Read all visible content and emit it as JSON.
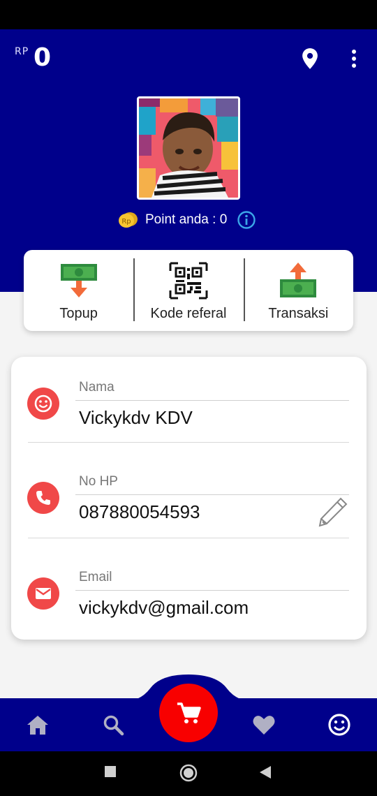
{
  "balance": {
    "currency_label": "RP",
    "amount": "0"
  },
  "header": {
    "location_icon": "location-pin-icon",
    "menu_icon": "more-vertical-icon"
  },
  "profile": {
    "point_text": "Point anda : 0",
    "coin_icon_text": "Rp"
  },
  "actions": [
    {
      "label": "Topup",
      "icon": "money-download-icon"
    },
    {
      "label": "Kode referal",
      "icon": "qr-code-icon"
    },
    {
      "label": "Transaksi",
      "icon": "money-upload-icon"
    }
  ],
  "fields": [
    {
      "label": "Nama",
      "value": "Vickykdv KDV",
      "icon": "smile-icon"
    },
    {
      "label": "No HP",
      "value": "087880054593",
      "icon": "phone-icon"
    },
    {
      "label": "Email",
      "value": "vickykdv@gmail.com",
      "icon": "mail-icon"
    }
  ],
  "bottom_nav": [
    "home-icon",
    "search-icon",
    "cart-icon",
    "heart-icon",
    "profile-icon"
  ],
  "colors": {
    "header_bg": "#00008b",
    "accent_red": "#f04848",
    "fab_red": "#f80000",
    "money_green": "#2e8b3e",
    "arrow_orange": "#f26b3a"
  }
}
